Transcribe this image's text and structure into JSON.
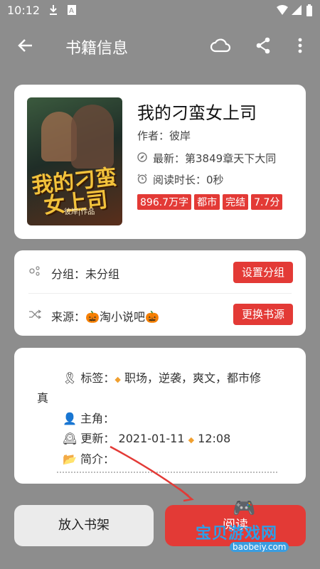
{
  "status_bar": {
    "time": "10:12"
  },
  "app_bar": {
    "title": "书籍信息"
  },
  "book": {
    "cover_title_line1": "我的刁蛮",
    "cover_title_line2": "女上司",
    "cover_author": "彼岸|作品",
    "title": "我的刁蛮女上司",
    "author_label": "作者：",
    "author": "彼岸",
    "latest_label": "最新：",
    "latest": "第3849章天下大同",
    "read_time_label": "阅读时长：",
    "read_time": "0秒",
    "badges": [
      "896.7万字",
      "都市",
      "完结",
      "7.7分"
    ]
  },
  "group": {
    "label": "分组：",
    "value": "未分组",
    "button": "设置分组"
  },
  "source": {
    "label": "来源：",
    "value": "🎃淘小说吧🎃",
    "button": "更换书源"
  },
  "details": {
    "tags_label": "标签：",
    "tags_line1": "职场，逆袭，爽文，都市修",
    "tags_line2": "真",
    "protagonist_label": "主角：",
    "update_label": "更新：",
    "update_date": "2021-01-11",
    "update_time": "12:08",
    "intro_label": "简介："
  },
  "bottom": {
    "shelf_button": "放入书架",
    "read_button": "阅读"
  },
  "watermark": {
    "text": "宝贝游戏网",
    "url": "baobeiy.com"
  },
  "colors": {
    "accent": "#e33a36",
    "background": "#8d8d8d",
    "card": "#ffffff"
  }
}
